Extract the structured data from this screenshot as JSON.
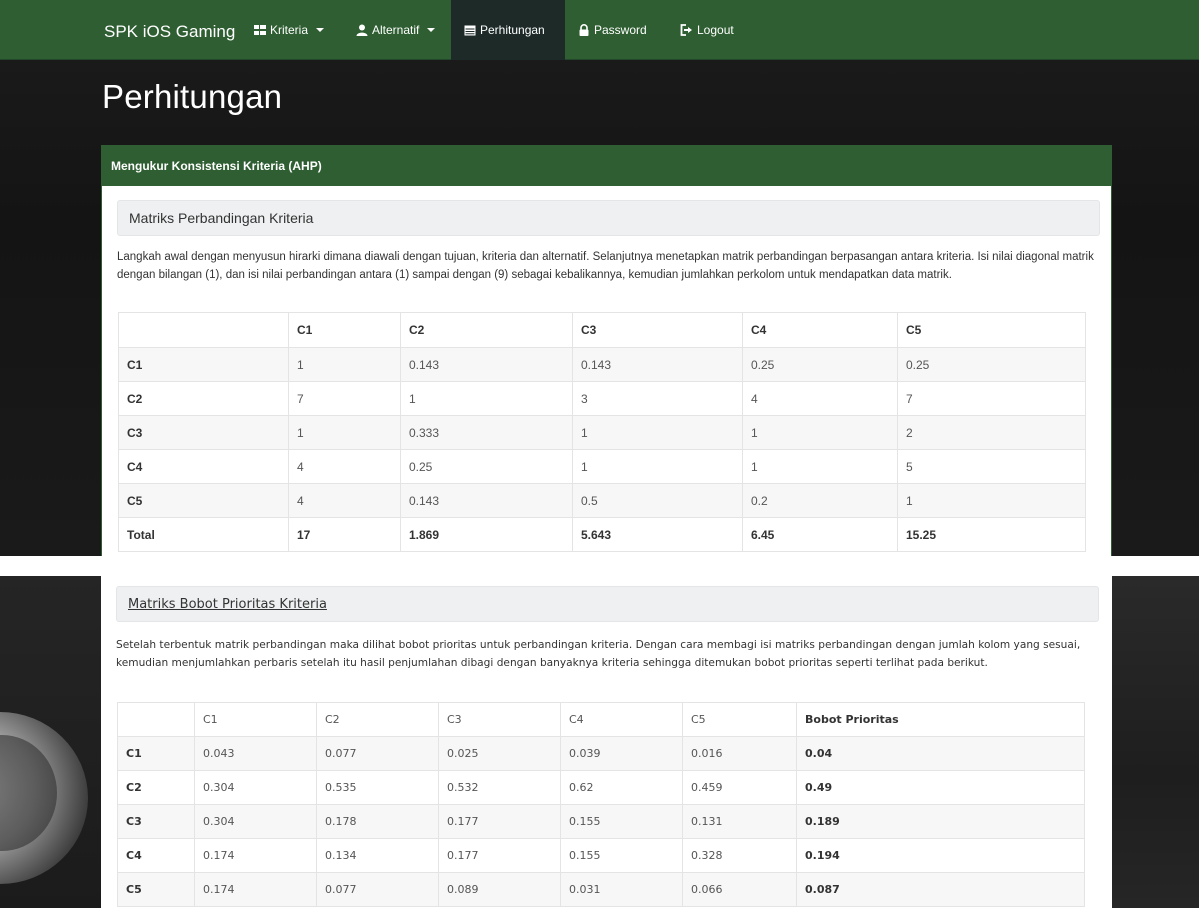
{
  "navbar": {
    "brand": "SPK iOS Gaming",
    "items": [
      {
        "label": "Kriteria",
        "icon": "grid-icon",
        "dropdown": true
      },
      {
        "label": "Alternatif",
        "icon": "user-icon",
        "dropdown": true
      },
      {
        "label": "Perhitungan",
        "icon": "calendar-icon",
        "active": true
      },
      {
        "label": "Password",
        "icon": "lock-icon"
      },
      {
        "label": "Logout",
        "icon": "logout-icon"
      }
    ],
    "colors": {
      "bar": "#2e5e31",
      "active": "#1d2a28"
    }
  },
  "page_title": "Perhitungan",
  "panel": {
    "heading": "Mengukur Konsistensi Kriteria (AHP)",
    "section1": {
      "title": "Matriks Perbandingan Kriteria",
      "description": "Langkah awal dengan menyusun hirarki dimana diawali dengan tujuan, kriteria dan alternatif. Selanjutnya menetapkan matrik perbandingan berpasangan antara kriteria. Isi nilai diagonal matrik dengan bilangan (1), dan isi nilai perbandingan antara (1) sampai dengan (9) sebagai kebalikannya, kemudian jumlahkan perkolom untuk mendapatkan data matrik.",
      "table": {
        "headers": [
          "",
          "C1",
          "C2",
          "C3",
          "C4",
          "C5"
        ],
        "rows": [
          [
            "C1",
            "1",
            "0.143",
            "0.143",
            "0.25",
            "0.25"
          ],
          [
            "C2",
            "7",
            "1",
            "3",
            "4",
            "7"
          ],
          [
            "C3",
            "1",
            "0.333",
            "1",
            "1",
            "2"
          ],
          [
            "C4",
            "4",
            "0.25",
            "1",
            "1",
            "5"
          ],
          [
            "C5",
            "4",
            "0.143",
            "0.5",
            "0.2",
            "1"
          ]
        ],
        "total": [
          "Total",
          "17",
          "1.869",
          "5.643",
          "6.45",
          "15.25"
        ]
      }
    },
    "section2": {
      "title": "Matriks Bobot Prioritas Kriteria",
      "description": "Setelah terbentuk matrik perbandingan maka dilihat bobot prioritas untuk perbandingan kriteria. Dengan cara membagi isi matriks perbandingan dengan jumlah kolom yang sesuai, kemudian menjumlahkan perbaris setelah itu hasil penjumlahan dibagi dengan banyaknya kriteria sehingga ditemukan bobot prioritas seperti terlihat pada berikut.",
      "table": {
        "headers": [
          "",
          "C1",
          "C2",
          "C3",
          "C4",
          "C5",
          "Bobot Prioritas"
        ],
        "rows": [
          [
            "C1",
            "0.043",
            "0.077",
            "0.025",
            "0.039",
            "0.016",
            "0.04"
          ],
          [
            "C2",
            "0.304",
            "0.535",
            "0.532",
            "0.62",
            "0.459",
            "0.49"
          ],
          [
            "C3",
            "0.304",
            "0.178",
            "0.177",
            "0.155",
            "0.131",
            "0.189"
          ],
          [
            "C4",
            "0.174",
            "0.134",
            "0.177",
            "0.155",
            "0.328",
            "0.194"
          ],
          [
            "C5",
            "0.174",
            "0.077",
            "0.089",
            "0.031",
            "0.066",
            "0.087"
          ]
        ]
      }
    }
  }
}
